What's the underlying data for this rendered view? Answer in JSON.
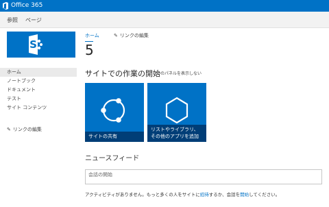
{
  "suite_bar": {
    "brand": "Office 365",
    "color": "#0072c6"
  },
  "ribbon": {
    "tabs": [
      "参照",
      "ページ"
    ]
  },
  "breadcrumb": {
    "home": "ホーム",
    "edit_links": "リンクの編集"
  },
  "site": {
    "title": "5",
    "logo_icon": "sharepoint-logo-icon"
  },
  "quick_launch": {
    "items": [
      "ホーム",
      "ノートブック",
      "ドキュメント",
      "テスト",
      "サイト コンテンツ"
    ],
    "selected_index": 0,
    "edit_links": "リンクの編集"
  },
  "getting_started": {
    "title": "サイトでの作業の開始",
    "hide": "このパネルを表示しない",
    "tiles": [
      {
        "label": "サイトの共有",
        "icon": "share-site-icon"
      },
      {
        "label": "リストやライブラリ、その他のアプリを追加",
        "icon": "add-app-icon"
      }
    ]
  },
  "newsfeed": {
    "title": "ニュースフィード",
    "placeholder": "会話の開始",
    "message": {
      "part1": "アクティビティがありません。もっと多くの人をサイトに",
      "link1": "招待",
      "part2": "するか、会話を",
      "link2": "開始",
      "part3": "してください。"
    }
  }
}
